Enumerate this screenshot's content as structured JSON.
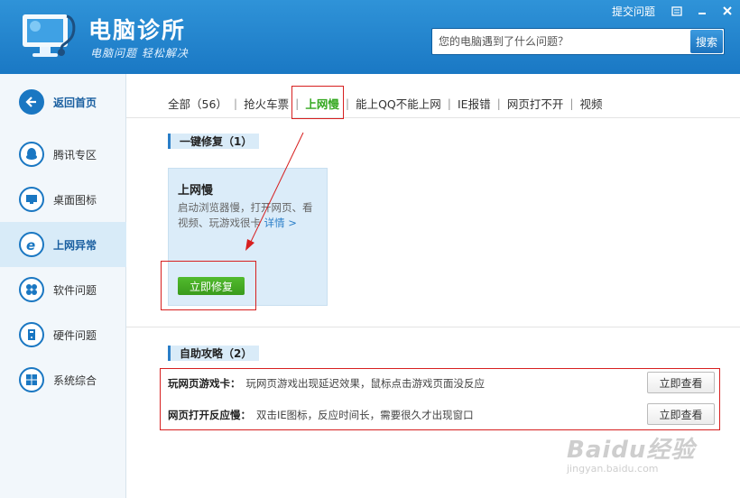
{
  "header": {
    "app_title": "电脑诊所",
    "app_subtitle": "电脑问题 轻松解决",
    "feedback_label": "提交问题",
    "search_placeholder": "您的电脑遇到了什么问题？",
    "search_button": "搜索"
  },
  "sidebar": {
    "items": [
      {
        "label": "返回首页",
        "icon": "back-arrow-icon"
      },
      {
        "label": "腾讯专区",
        "icon": "qq-penguin-icon"
      },
      {
        "label": "桌面图标",
        "icon": "monitor-icon"
      },
      {
        "label": "上网异常",
        "icon": "ie-browser-icon",
        "active": true
      },
      {
        "label": "软件问题",
        "icon": "software-icon"
      },
      {
        "label": "硬件问题",
        "icon": "hardware-icon"
      },
      {
        "label": "系统综合",
        "icon": "windows-icon"
      }
    ]
  },
  "tabs": [
    {
      "label": "全部（56）"
    },
    {
      "label": "抢火车票"
    },
    {
      "label": "上网慢",
      "active": true
    },
    {
      "label": "能上QQ不能上网"
    },
    {
      "label": "IE报错"
    },
    {
      "label": "网页打不开"
    },
    {
      "label": "视频"
    }
  ],
  "quick_fix": {
    "section_title": "一键修复（1）",
    "card_title": "上网慢",
    "card_desc": "启动浏览器慢，打开网页、看视频、玩游戏很卡",
    "card_link": "详情 >",
    "fix_button": "立即修复"
  },
  "self_help": {
    "section_title": "自助攻略（2）",
    "items": [
      {
        "title": "玩网页游戏卡：",
        "desc": "玩网页游戏出现延迟效果，鼠标点击游戏页面没反应",
        "button": "立即查看"
      },
      {
        "title": "网页打开反应慢：",
        "desc": "双击IE图标，反应时间长，需要很久才出现窗口",
        "button": "立即查看"
      }
    ]
  },
  "watermark": {
    "brand": "Baidu经验",
    "url": "jingyan.baidu.com"
  },
  "colors": {
    "header_blue": "#1f84cd",
    "accent_green": "#3a9b1c",
    "annotation_red": "#d71f1f"
  }
}
